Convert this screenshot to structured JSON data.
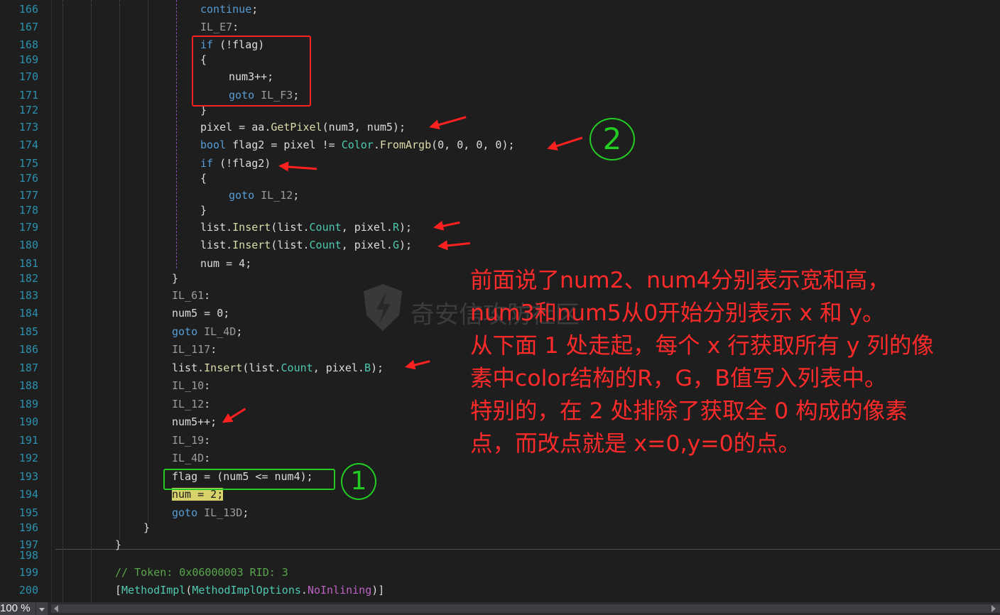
{
  "editor": {
    "lines": [
      {
        "num": "166",
        "indent": 7,
        "tokens": [
          [
            "k",
            "continue"
          ],
          [
            "p",
            ";"
          ]
        ]
      },
      {
        "num": "167",
        "indent": 7,
        "tokens": [
          [
            "lb",
            "IL_E7"
          ],
          [
            "p",
            ":"
          ]
        ]
      },
      {
        "num": "168",
        "indent": 7,
        "tokens": [
          [
            "k",
            "if"
          ],
          [
            "p",
            " (!flag)"
          ]
        ]
      },
      {
        "num": "169",
        "indent": 7,
        "tokens": [
          [
            "p",
            "{"
          ]
        ]
      },
      {
        "num": "170",
        "indent": 8,
        "tokens": [
          [
            "p",
            "num3++;"
          ]
        ]
      },
      {
        "num": "171",
        "indent": 8,
        "tokens": [
          [
            "k",
            "goto"
          ],
          [
            "p",
            " "
          ],
          [
            "lb",
            "IL_F3"
          ],
          [
            "p",
            ";"
          ]
        ]
      },
      {
        "num": "172",
        "indent": 7,
        "tokens": [
          [
            "p",
            "}"
          ]
        ]
      },
      {
        "num": "173",
        "indent": 7,
        "tokens": [
          [
            "p",
            "pixel = "
          ],
          [
            "p",
            "aa"
          ],
          [
            "p",
            "."
          ],
          [
            "m",
            "GetPixel"
          ],
          [
            "p",
            "(num3, num5);"
          ]
        ]
      },
      {
        "num": "174",
        "indent": 7,
        "tokens": [
          [
            "k",
            "bool"
          ],
          [
            "p",
            " flag2 = pixel != "
          ],
          [
            "t",
            "Color"
          ],
          [
            "p",
            "."
          ],
          [
            "m",
            "FromArgb"
          ],
          [
            "p",
            "(0, 0, 0, 0);"
          ]
        ]
      },
      {
        "num": "175",
        "indent": 7,
        "tokens": [
          [
            "k",
            "if"
          ],
          [
            "p",
            " (!flag2)"
          ]
        ]
      },
      {
        "num": "176",
        "indent": 7,
        "tokens": [
          [
            "p",
            "{"
          ]
        ]
      },
      {
        "num": "177",
        "indent": 8,
        "tokens": [
          [
            "k",
            "goto"
          ],
          [
            "p",
            " "
          ],
          [
            "lb",
            "IL_12"
          ],
          [
            "p",
            ";"
          ]
        ]
      },
      {
        "num": "178",
        "indent": 7,
        "tokens": [
          [
            "p",
            "}"
          ]
        ]
      },
      {
        "num": "179",
        "indent": 7,
        "tokens": [
          [
            "p",
            "list."
          ],
          [
            "m",
            "Insert"
          ],
          [
            "p",
            "(list."
          ],
          [
            "f",
            "Count"
          ],
          [
            "p",
            ", pixel."
          ],
          [
            "f",
            "R"
          ],
          [
            "p",
            ");"
          ]
        ]
      },
      {
        "num": "180",
        "indent": 7,
        "tokens": [
          [
            "p",
            "list."
          ],
          [
            "m",
            "Insert"
          ],
          [
            "p",
            "(list."
          ],
          [
            "f",
            "Count"
          ],
          [
            "p",
            ", pixel."
          ],
          [
            "f",
            "G"
          ],
          [
            "p",
            ");"
          ]
        ]
      },
      {
        "num": "181",
        "indent": 7,
        "tokens": [
          [
            "p",
            "num = 4;"
          ]
        ]
      },
      {
        "num": "182",
        "indent": 6,
        "tokens": [
          [
            "p",
            "}"
          ]
        ]
      },
      {
        "num": "183",
        "indent": 6,
        "tokens": [
          [
            "lb",
            "IL_61"
          ],
          [
            "p",
            ":"
          ]
        ]
      },
      {
        "num": "184",
        "indent": 6,
        "tokens": [
          [
            "p",
            "num5 = 0;"
          ]
        ]
      },
      {
        "num": "185",
        "indent": 6,
        "tokens": [
          [
            "k",
            "goto"
          ],
          [
            "p",
            " "
          ],
          [
            "lb",
            "IL_4D"
          ],
          [
            "p",
            ";"
          ]
        ]
      },
      {
        "num": "186",
        "indent": 6,
        "tokens": [
          [
            "lb",
            "IL_117"
          ],
          [
            "p",
            ":"
          ]
        ]
      },
      {
        "num": "187",
        "indent": 6,
        "tokens": [
          [
            "p",
            "list."
          ],
          [
            "m",
            "Insert"
          ],
          [
            "p",
            "(list."
          ],
          [
            "f",
            "Count"
          ],
          [
            "p",
            ", pixel."
          ],
          [
            "f",
            "B"
          ],
          [
            "p",
            ");"
          ]
        ]
      },
      {
        "num": "188",
        "indent": 6,
        "tokens": [
          [
            "lb",
            "IL_10"
          ],
          [
            "p",
            ":"
          ]
        ]
      },
      {
        "num": "189",
        "indent": 6,
        "tokens": [
          [
            "lb",
            "IL_12"
          ],
          [
            "p",
            ":"
          ]
        ]
      },
      {
        "num": "190",
        "indent": 6,
        "tokens": [
          [
            "p",
            "num5++;"
          ]
        ]
      },
      {
        "num": "191",
        "indent": 6,
        "tokens": [
          [
            "lb",
            "IL_19"
          ],
          [
            "p",
            ":"
          ]
        ]
      },
      {
        "num": "192",
        "indent": 6,
        "tokens": [
          [
            "lb",
            "IL_4D"
          ],
          [
            "p",
            ":"
          ]
        ]
      },
      {
        "num": "193",
        "indent": 6,
        "tokens": [
          [
            "p",
            "flag = (num5 <= num4);"
          ]
        ]
      },
      {
        "num": "194",
        "indent": 6,
        "tokens": [
          [
            "hl",
            "num = 2;"
          ]
        ]
      },
      {
        "num": "195",
        "indent": 6,
        "tokens": [
          [
            "k",
            "goto"
          ],
          [
            "p",
            " "
          ],
          [
            "lb",
            "IL_13D"
          ],
          [
            "p",
            ";"
          ]
        ]
      },
      {
        "num": "196",
        "indent": 5,
        "tokens": [
          [
            "p",
            "}"
          ]
        ]
      },
      {
        "num": "197",
        "indent": 4,
        "tokens": [
          [
            "p",
            "}"
          ]
        ]
      },
      {
        "num": "198",
        "indent": 4,
        "tokens": []
      },
      {
        "num": "199",
        "indent": 4,
        "tokens": [
          [
            "c",
            "// Token: 0x06000003 RID: 3"
          ]
        ]
      },
      {
        "num": "200",
        "indent": 4,
        "tokens": [
          [
            "p",
            "["
          ],
          [
            "t",
            "MethodImpl"
          ],
          [
            "p",
            "("
          ],
          [
            "t",
            "MethodImplOptions"
          ],
          [
            "p",
            "."
          ],
          [
            "em",
            "NoInlining"
          ],
          [
            "p",
            ")]"
          ]
        ]
      }
    ]
  },
  "annotations": {
    "marker_two": "2",
    "marker_one": "1",
    "note_lines": [
      "前面说了num2、num4分别表示宽和高，",
      "num3和num5从0开始分别表示 x 和 y。",
      "从下面 1 处走起，每个 x 行获取所有 y 列的像",
      "素中color结构的R，G，B值写入列表中。",
      "特别的，在 2 处排除了获取全 0 构成的像素",
      "点，而改点就是 x=0,y=0的点。"
    ],
    "watermark": "奇安信攻防社区"
  },
  "statusbar": {
    "zoom": "100 %"
  },
  "colors": {
    "background": "#1e1e1e",
    "line_number": "#2b91af",
    "keyword": "#569cd6",
    "method": "#dcdcaa",
    "type": "#4ec9b0",
    "comment": "#57a64a",
    "annotation_red": "#ff2a2a",
    "annotation_green": "#22cc22",
    "highlight": "#d7d26a"
  }
}
